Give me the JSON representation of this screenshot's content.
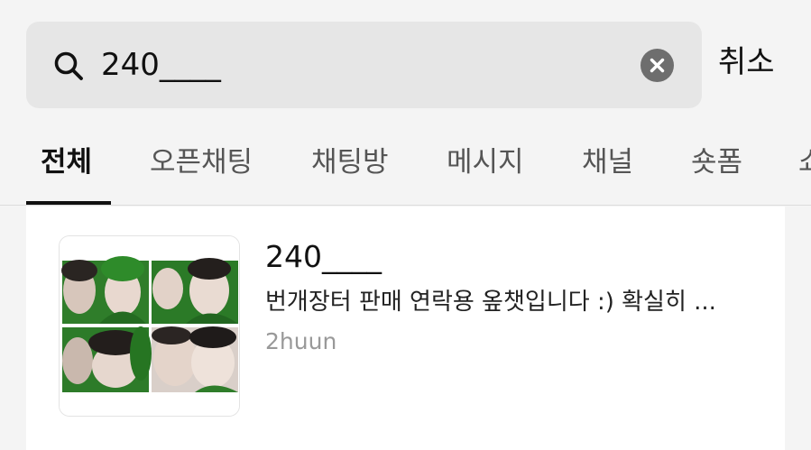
{
  "search": {
    "query": "240____",
    "cancel_label": "취소"
  },
  "tabs": [
    {
      "label": "전체",
      "active": true
    },
    {
      "label": "오픈채팅",
      "active": false
    },
    {
      "label": "채팅방",
      "active": false
    },
    {
      "label": "메시지",
      "active": false
    },
    {
      "label": "채널",
      "active": false
    },
    {
      "label": "숏폼",
      "active": false
    },
    {
      "label": "쇼",
      "active": false
    }
  ],
  "results": [
    {
      "title": "240____",
      "description": "번개장터 판매 연락용 옾챗입니다 :) 확실히 ...",
      "owner": "2huun"
    }
  ],
  "colors": {
    "background": "#f4f4f4",
    "search_box": "#e6e6e6",
    "clear_button": "#6e6e6e",
    "card": "#ffffff",
    "muted_text": "#999999",
    "photo_green": "#2f7d2a"
  },
  "icons": {
    "search": "search-icon",
    "clear": "clear-icon"
  }
}
